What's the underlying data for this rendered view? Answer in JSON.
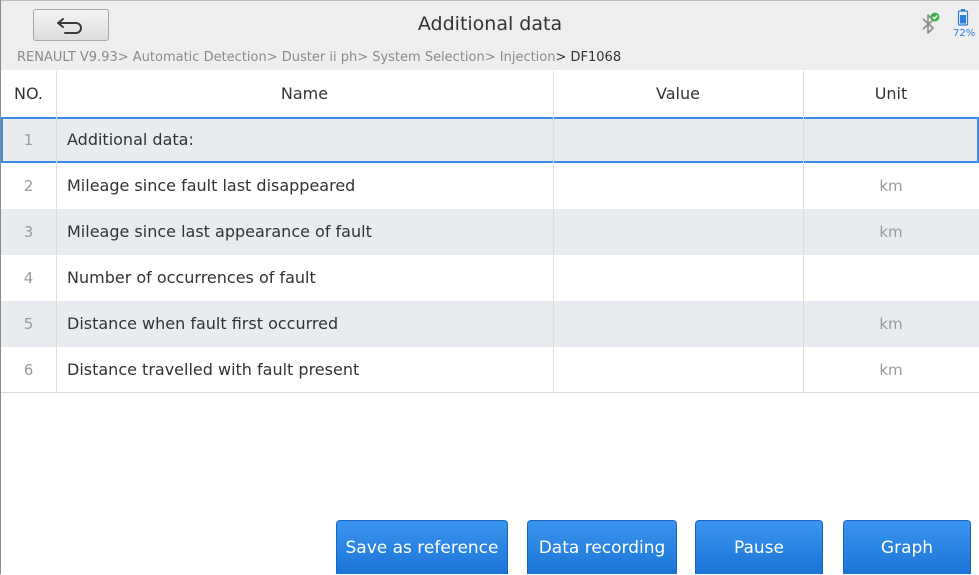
{
  "header": {
    "title": "Additional data",
    "battery_percent": "72%"
  },
  "breadcrumb": {
    "path": "RENAULT V9.93> Automatic Detection> Duster ii ph> System Selection> Injection",
    "current": "> DF1068"
  },
  "table": {
    "columns": {
      "no": "NO.",
      "name": "Name",
      "value": "Value",
      "unit": "Unit"
    },
    "rows": [
      {
        "no": "1",
        "name": "Additional data:",
        "value": "",
        "unit": ""
      },
      {
        "no": "2",
        "name": "Mileage since fault last disappeared",
        "value": "",
        "unit": "km"
      },
      {
        "no": "3",
        "name": "Mileage since last appearance of fault",
        "value": "",
        "unit": "km"
      },
      {
        "no": "4",
        "name": "Number of occurrences of fault",
        "value": "",
        "unit": ""
      },
      {
        "no": "5",
        "name": "Distance when fault first occurred",
        "value": "",
        "unit": "km"
      },
      {
        "no": "6",
        "name": "Distance travelled with fault present",
        "value": "",
        "unit": "km"
      }
    ]
  },
  "buttons": {
    "save_reference": "Save as reference",
    "data_recording": "Data recording",
    "pause": "Pause",
    "graph": "Graph"
  },
  "colors": {
    "accent": "#1a74d6",
    "bluetooth_status": "#3cb44b",
    "battery": "#2d7fd8"
  },
  "icons": {
    "back": "back-arrow-icon",
    "bluetooth": "bluetooth-connected-icon",
    "battery": "battery-icon"
  }
}
